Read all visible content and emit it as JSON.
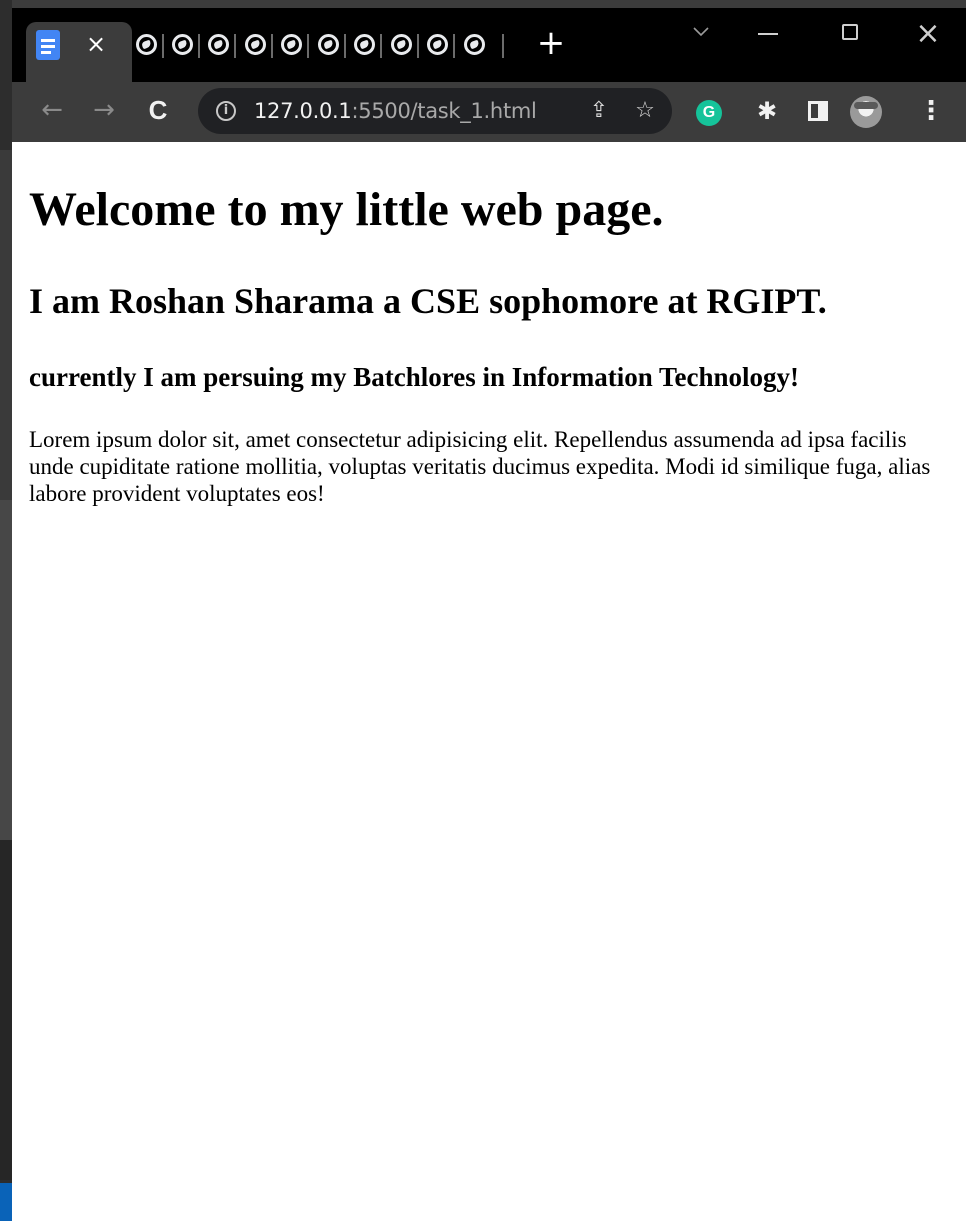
{
  "browser": {
    "tabs": {
      "active_icon": "docs-icon",
      "close_icon": "close-icon",
      "inactive_tab_icon": "globe-icon",
      "inactive_tab_count": 10,
      "new_tab_label": "+"
    },
    "window_controls": {
      "tab_search_icon": "chevron-down-icon",
      "minimize_icon": "minimize-icon",
      "maximize_icon": "maximize-icon",
      "close_icon": "close-icon"
    },
    "toolbar": {
      "back_label": "←",
      "forward_label": "→",
      "reload_label": "C",
      "url_host": "127.0.0.1",
      "url_rest": ":5500/task_1.html",
      "share_label": "⇪",
      "bookmark_label": "☆",
      "grammarly_label": "G",
      "extensions_label": "✱",
      "menu_label": "⋮"
    }
  },
  "page": {
    "h1": "Welcome to my little web page.",
    "h2": "I am Roshan Sharama a CSE sophomore at RGIPT.",
    "h3": "currently I am persuing my Batchlores in Information Technology!",
    "paragraph": "Lorem ipsum dolor sit, amet consectetur adipisicing elit. Repellendus assumenda ad ipsa facilis unde cupiditate ratione mollitia, voluptas veritatis ducimus expedita. Modi id similique fuga, alias labore provident voluptates eos!"
  },
  "colors": {
    "tab_strip": "#000000",
    "toolbar": "#3c3c3c",
    "omnibox": "#202124",
    "grammarly": "#15c39a",
    "docs_blue": "#4285f4",
    "taskbar_accent": "#0a63b8"
  }
}
